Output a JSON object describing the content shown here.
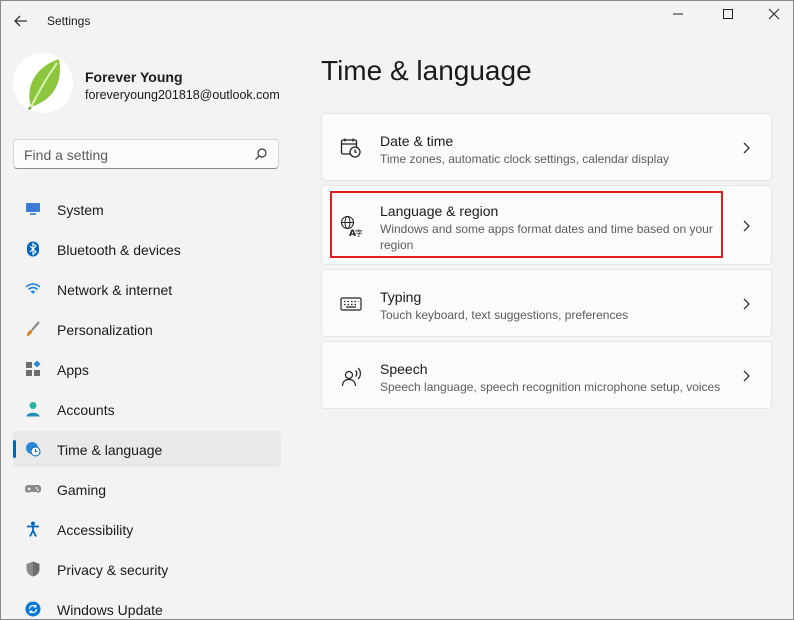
{
  "window": {
    "title": "Settings"
  },
  "profile": {
    "name": "Forever Young",
    "email": "foreveryoung201818@outlook.com"
  },
  "search": {
    "placeholder": "Find a setting"
  },
  "sidebar": {
    "items": [
      {
        "label": "System",
        "icon": "monitor-icon",
        "color": "#3a7bd5"
      },
      {
        "label": "Bluetooth & devices",
        "icon": "bluetooth-icon",
        "color": "#0067c0"
      },
      {
        "label": "Network & internet",
        "icon": "wifi-icon",
        "color": "#2b88d8"
      },
      {
        "label": "Personalization",
        "icon": "brush-icon",
        "color": "#d9822b"
      },
      {
        "label": "Apps",
        "icon": "apps-icon",
        "color": "#5c5c5c"
      },
      {
        "label": "Accounts",
        "icon": "person-icon",
        "color": "#2bb3a0"
      },
      {
        "label": "Time & language",
        "icon": "globe-clock-icon",
        "color": "#0078d4",
        "active": true
      },
      {
        "label": "Gaming",
        "icon": "gamepad-icon",
        "color": "#7a7a7a"
      },
      {
        "label": "Accessibility",
        "icon": "accessibility-icon",
        "color": "#0067c0"
      },
      {
        "label": "Privacy & security",
        "icon": "shield-icon",
        "color": "#7a7a7a"
      },
      {
        "label": "Windows Update",
        "icon": "update-icon",
        "color": "#0078d4"
      }
    ]
  },
  "main": {
    "title": "Time & language",
    "cards": [
      {
        "title": "Date & time",
        "description": "Time zones, automatic clock settings, calendar display",
        "icon": "calendar-clock-icon"
      },
      {
        "title": "Language & region",
        "description": "Windows and some apps format dates and time based on your region",
        "icon": "language-icon",
        "highlighted": true
      },
      {
        "title": "Typing",
        "description": "Touch keyboard, text suggestions, preferences",
        "icon": "keyboard-icon"
      },
      {
        "title": "Speech",
        "description": "Speech language, speech recognition microphone setup, voices",
        "icon": "speech-icon"
      }
    ]
  },
  "colors": {
    "accent": "#0067c0",
    "highlight": "#e01e1e"
  }
}
